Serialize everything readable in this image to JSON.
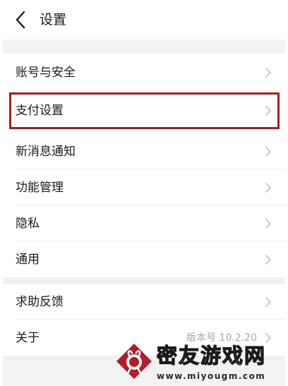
{
  "header": {
    "title": "设置",
    "back_icon": "chevron-left-icon"
  },
  "colors": {
    "highlight_border": "#a0201e",
    "section_band": "#f2f2f2",
    "text_primary": "#1a1a1a",
    "text_secondary": "#a8a8a8",
    "watermark_logo": "#b01c2a"
  },
  "sections": [
    {
      "items": [
        {
          "label": "账号与安全"
        },
        {
          "label": "支付设置",
          "highlighted": true
        },
        {
          "label": "新消息通知"
        },
        {
          "label": "功能管理"
        },
        {
          "label": "隐私"
        },
        {
          "label": "通用"
        }
      ]
    },
    {
      "items": [
        {
          "label": "求助反馈"
        },
        {
          "label": "关于",
          "value": "版本号 10.2.20"
        }
      ]
    }
  ],
  "watermark": {
    "site_name": "密友游戏网",
    "url": "www.miyougm.com"
  }
}
